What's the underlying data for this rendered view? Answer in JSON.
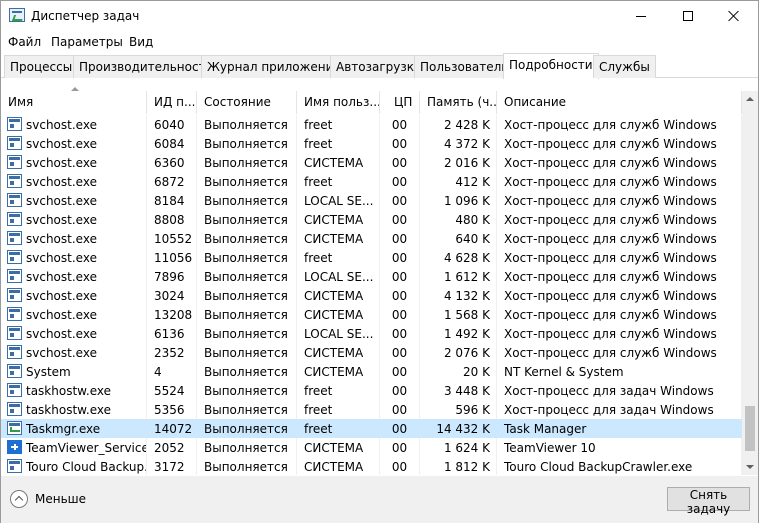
{
  "window": {
    "title": "Диспетчер задач"
  },
  "menu": [
    "Файл",
    "Параметры",
    "Вид"
  ],
  "tabs": [
    {
      "label": "Процессы"
    },
    {
      "label": "Производительность"
    },
    {
      "label": "Журнал приложений"
    },
    {
      "label": "Автозагрузка"
    },
    {
      "label": "Пользователи"
    },
    {
      "label": "Подробности",
      "active": true
    },
    {
      "label": "Службы"
    }
  ],
  "columns": [
    "Имя",
    "ИД п...",
    "Состояние",
    "Имя польз...",
    "ЦП",
    "Память (ч...",
    "Описание"
  ],
  "rows": [
    {
      "name": "svchost.exe",
      "pid": "6040",
      "status": "Выполняется",
      "user": "freet",
      "cpu": "00",
      "mem": "2 428 K",
      "desc": "Хост-процесс для служб Windows",
      "icon": "window-icon"
    },
    {
      "name": "svchost.exe",
      "pid": "6084",
      "status": "Выполняется",
      "user": "freet",
      "cpu": "00",
      "mem": "4 372 K",
      "desc": "Хост-процесс для служб Windows",
      "icon": "window-icon"
    },
    {
      "name": "svchost.exe",
      "pid": "6360",
      "status": "Выполняется",
      "user": "СИСТЕМА",
      "cpu": "00",
      "mem": "2 016 K",
      "desc": "Хост-процесс для служб Windows",
      "icon": "window-icon"
    },
    {
      "name": "svchost.exe",
      "pid": "6872",
      "status": "Выполняется",
      "user": "freet",
      "cpu": "00",
      "mem": "412 K",
      "desc": "Хост-процесс для служб Windows",
      "icon": "window-icon"
    },
    {
      "name": "svchost.exe",
      "pid": "8184",
      "status": "Выполняется",
      "user": "LOCAL SE...",
      "cpu": "00",
      "mem": "1 096 K",
      "desc": "Хост-процесс для служб Windows",
      "icon": "window-icon"
    },
    {
      "name": "svchost.exe",
      "pid": "8808",
      "status": "Выполняется",
      "user": "СИСТЕМА",
      "cpu": "00",
      "mem": "480 K",
      "desc": "Хост-процесс для служб Windows",
      "icon": "window-icon"
    },
    {
      "name": "svchost.exe",
      "pid": "10552",
      "status": "Выполняется",
      "user": "СИСТЕМА",
      "cpu": "00",
      "mem": "640 K",
      "desc": "Хост-процесс для служб Windows",
      "icon": "window-icon"
    },
    {
      "name": "svchost.exe",
      "pid": "11056",
      "status": "Выполняется",
      "user": "freet",
      "cpu": "00",
      "mem": "4 628 K",
      "desc": "Хост-процесс для служб Windows",
      "icon": "window-icon"
    },
    {
      "name": "svchost.exe",
      "pid": "7896",
      "status": "Выполняется",
      "user": "LOCAL SE...",
      "cpu": "00",
      "mem": "1 612 K",
      "desc": "Хост-процесс для служб Windows",
      "icon": "window-icon"
    },
    {
      "name": "svchost.exe",
      "pid": "3024",
      "status": "Выполняется",
      "user": "СИСТЕМА",
      "cpu": "00",
      "mem": "4 132 K",
      "desc": "Хост-процесс для служб Windows",
      "icon": "window-icon"
    },
    {
      "name": "svchost.exe",
      "pid": "13208",
      "status": "Выполняется",
      "user": "СИСТЕМА",
      "cpu": "00",
      "mem": "1 568 K",
      "desc": "Хост-процесс для служб Windows",
      "icon": "window-icon"
    },
    {
      "name": "svchost.exe",
      "pid": "6136",
      "status": "Выполняется",
      "user": "LOCAL SE...",
      "cpu": "00",
      "mem": "1 492 K",
      "desc": "Хост-процесс для служб Windows",
      "icon": "window-icon"
    },
    {
      "name": "svchost.exe",
      "pid": "2352",
      "status": "Выполняется",
      "user": "СИСТЕМА",
      "cpu": "00",
      "mem": "2 076 K",
      "desc": "Хост-процесс для служб Windows",
      "icon": "window-icon"
    },
    {
      "name": "System",
      "pid": "4",
      "status": "Выполняется",
      "user": "СИСТЕМА",
      "cpu": "00",
      "mem": "20 K",
      "desc": "NT Kernel & System",
      "icon": "window-icon"
    },
    {
      "name": "taskhostw.exe",
      "pid": "5524",
      "status": "Выполняется",
      "user": "freet",
      "cpu": "00",
      "mem": "3 448 K",
      "desc": "Хост-процесс для задач Windows",
      "icon": "window-icon"
    },
    {
      "name": "taskhostw.exe",
      "pid": "5356",
      "status": "Выполняется",
      "user": "freet",
      "cpu": "00",
      "mem": "596 K",
      "desc": "Хост-процесс для задач Windows",
      "icon": "window-icon"
    },
    {
      "name": "Taskmgr.exe",
      "pid": "14072",
      "status": "Выполняется",
      "user": "freet",
      "cpu": "00",
      "mem": "14 432 K",
      "desc": "Task Manager",
      "icon": "task-manager-icon",
      "selected": true
    },
    {
      "name": "TeamViewer_Service....",
      "pid": "2052",
      "status": "Выполняется",
      "user": "СИСТЕМА",
      "cpu": "00",
      "mem": "1 624 K",
      "desc": "TeamViewer 10",
      "icon": "teamviewer-icon"
    },
    {
      "name": "Touro Cloud Backup...",
      "pid": "3172",
      "status": "Выполняется",
      "user": "СИСТЕМА",
      "cpu": "00",
      "mem": "1 812 K",
      "desc": "Touro Cloud BackupCrawler.exe",
      "icon": "window-icon"
    }
  ],
  "footer": {
    "less_label": "Меньше",
    "end_task_label": "Снять задачу"
  }
}
